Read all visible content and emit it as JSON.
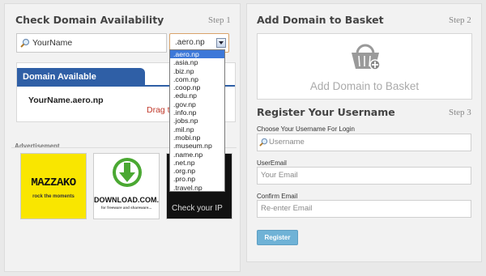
{
  "left_panel": {
    "title": "Check Domain Availability",
    "step": "Step 1",
    "search": {
      "value": "YourName"
    },
    "extension_select": {
      "selected": ".aero.np",
      "options": [
        ".aero.np",
        ".asia.np",
        ".biz.np",
        ".com.np",
        ".coop.np",
        ".edu.np",
        ".gov.np",
        ".info.np",
        ".jobs.np",
        ".mil.np",
        ".mobi.np",
        ".museum.np",
        ".name.np",
        ".net.np",
        ".org.np",
        ".pro.np",
        ".travel.np"
      ]
    },
    "result": {
      "heading": "Domain Available",
      "domain": "YourName.aero.np",
      "drag_hint": "Drag th"
    },
    "advertisement": {
      "title": "Advertisement",
      "ads": [
        {
          "brand": "MAZZAKO",
          "tagline": "rock the moments"
        },
        {
          "brand": "DOWNLOAD.COM.NP",
          "tagline": "for freeware and shareware..."
        },
        {
          "brand": "Check your IP"
        }
      ]
    }
  },
  "right_panel": {
    "basket": {
      "title": "Add Domain to Basket",
      "step": "Step 2",
      "drop_label": "Add Domain to Basket"
    },
    "register": {
      "title": "Register Your Username",
      "step": "Step 3",
      "username_label": "Choose Your Username For Login",
      "username_placeholder": "Username",
      "email_label": "UserEmail",
      "email_placeholder": "Your Email",
      "confirm_label": "Confirm Email",
      "confirm_placeholder": "Re-enter Email",
      "submit": "Register"
    }
  },
  "colors": {
    "accent": "#2f5fa6",
    "button": "#6fb2d6",
    "highlight": "#3d78d8",
    "warning_text": "#c0392b"
  }
}
